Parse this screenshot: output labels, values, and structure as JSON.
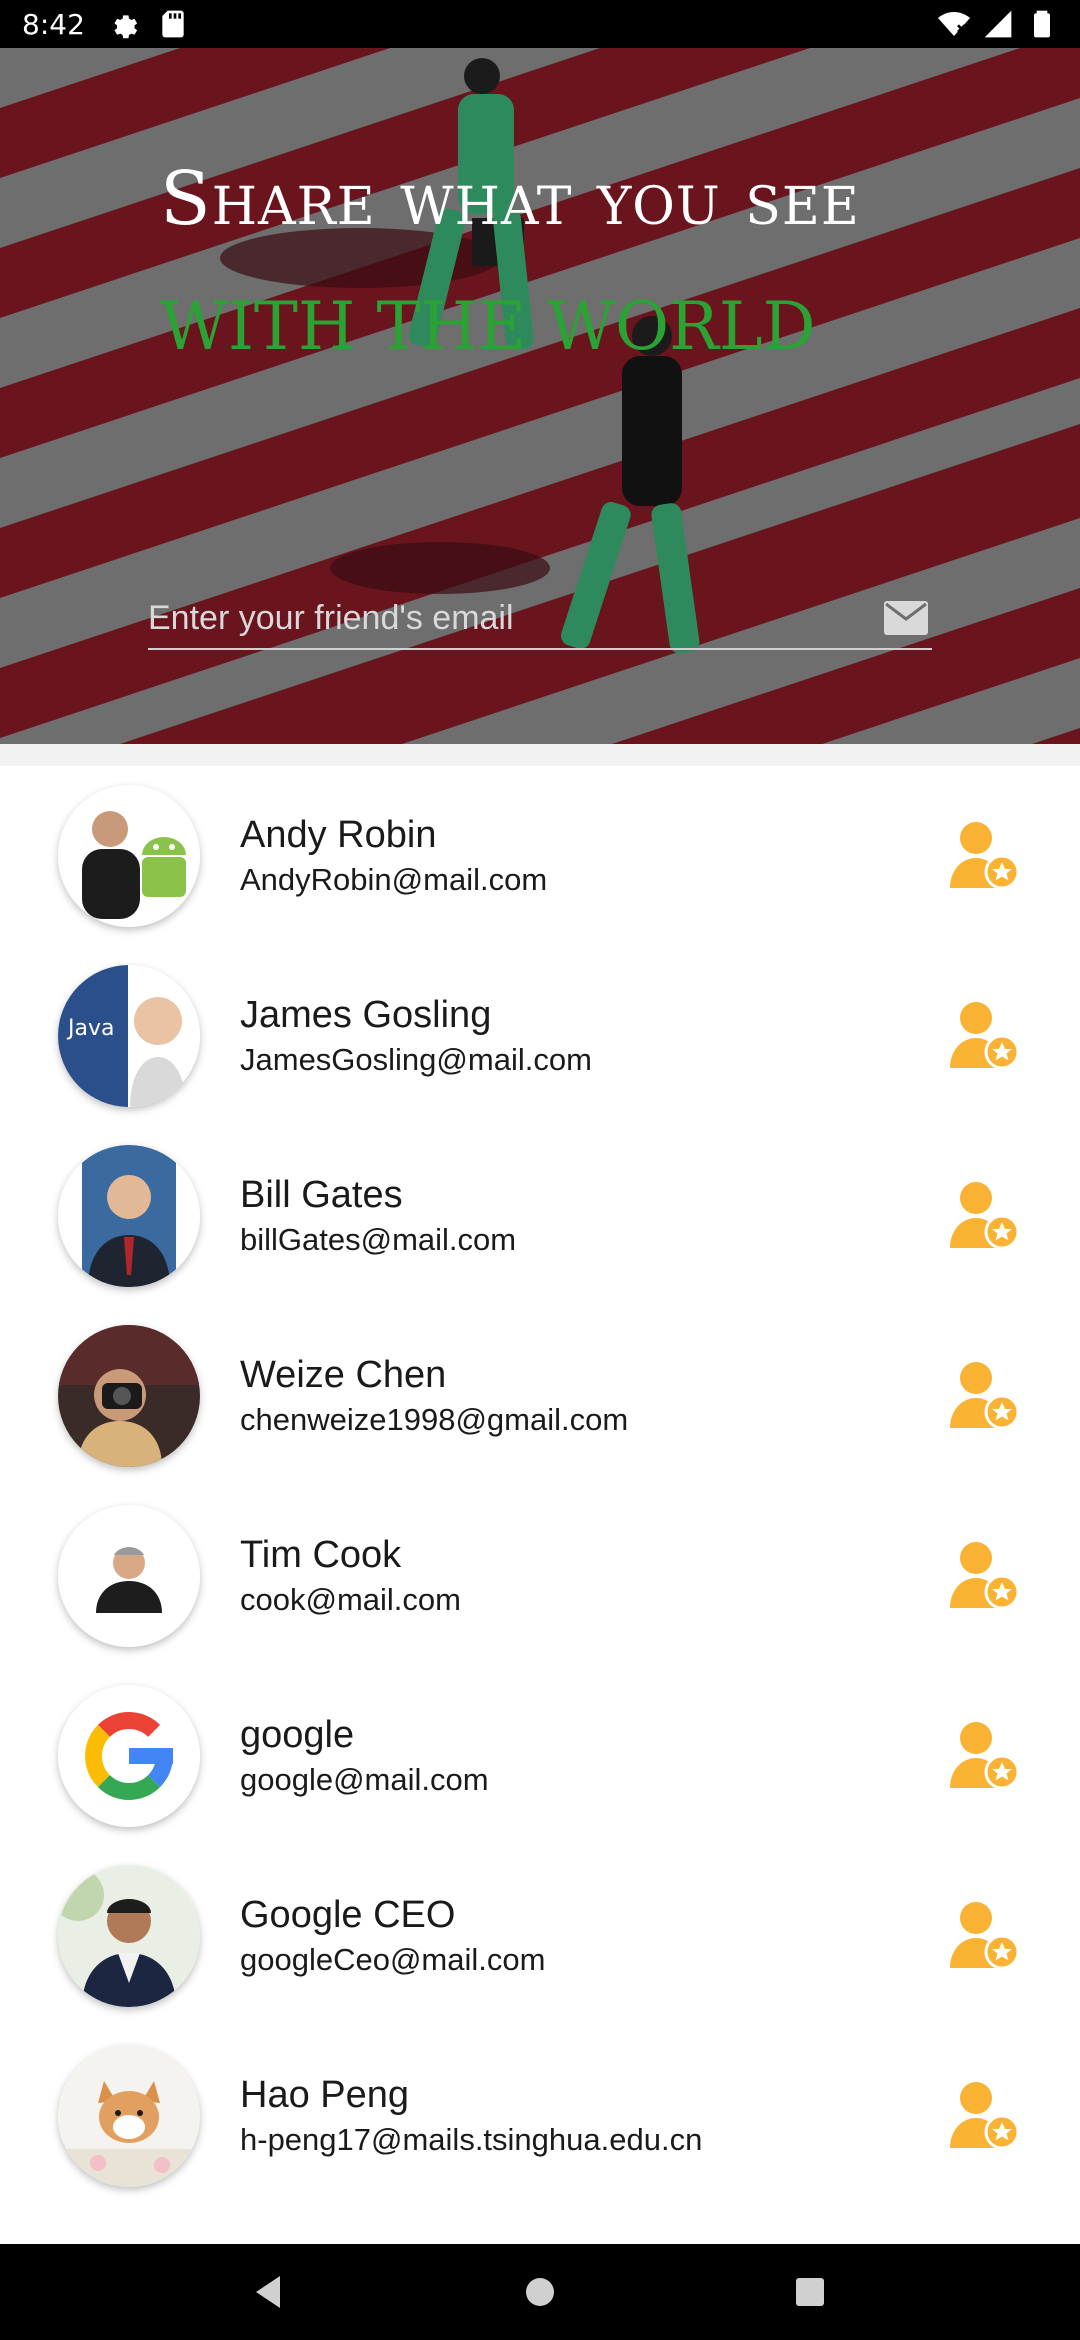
{
  "status_bar": {
    "time": "8:42",
    "left_icons": [
      "gear-icon",
      "sd-card-icon"
    ],
    "right_icons": [
      "wifi-icon",
      "signal-icon",
      "battery-icon"
    ]
  },
  "hero": {
    "title_line1": "Share what you see",
    "title_line2": "with the world",
    "email_placeholder": "Enter your friend's email",
    "email_value": "",
    "send_icon": "mail-icon",
    "colors": {
      "stripe": "#6a141e",
      "title_white": "#ffffff",
      "title_green": "#2aa234"
    }
  },
  "friends": [
    {
      "name": "Andy Robin",
      "email": "AndyRobin@mail.com",
      "avatar": "android-avatar"
    },
    {
      "name": "James Gosling",
      "email": "JamesGosling@mail.com",
      "avatar": "java-avatar"
    },
    {
      "name": "Bill Gates",
      "email": "billGates@mail.com",
      "avatar": "portrait-avatar"
    },
    {
      "name": "Weize Chen",
      "email": "chenweize1998@gmail.com",
      "avatar": "camera-avatar"
    },
    {
      "name": "Tim Cook",
      "email": "cook@mail.com",
      "avatar": "portrait-avatar"
    },
    {
      "name": "google",
      "email": "google@mail.com",
      "avatar": "google-logo-avatar"
    },
    {
      "name": "Google CEO",
      "email": "googleCeo@mail.com",
      "avatar": "portrait-avatar"
    },
    {
      "name": "Hao Peng",
      "email": "h-peng17@mails.tsinghua.edu.cn",
      "avatar": "dog-avatar"
    }
  ],
  "friend_action_icon": "add-favorite-friend-icon",
  "accent_color": "#f9b233",
  "nav_bar": {
    "buttons": [
      "back-icon",
      "home-icon",
      "recents-icon"
    ]
  }
}
